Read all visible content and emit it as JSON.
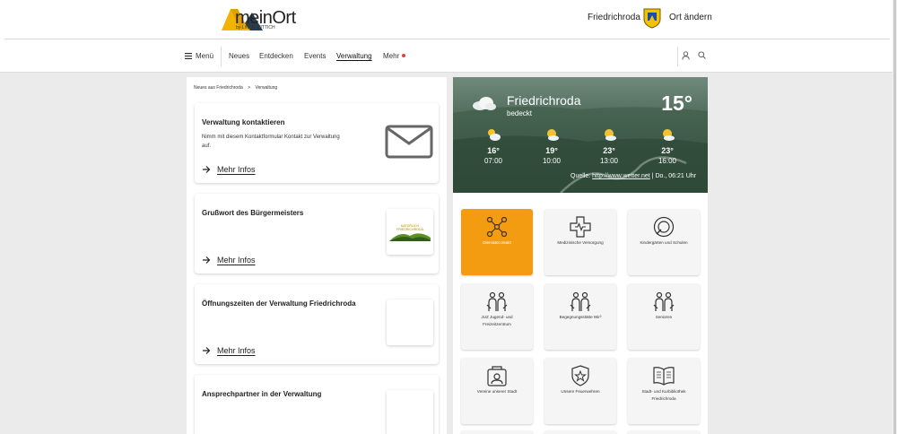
{
  "header": {
    "logo_text": "meinOrt",
    "logo_sub": "by LINUS WITTICH",
    "town": "Friedrichroda",
    "change_location": "Ort ändern"
  },
  "nav": {
    "menu": "Menü",
    "items": [
      "Neues",
      "Entdecken",
      "Events",
      "Verwaltung",
      "Mehr"
    ],
    "active": "Verwaltung"
  },
  "breadcrumb": [
    "Neues aus Friedrichroda",
    ">",
    "Verwaltung"
  ],
  "cards": [
    {
      "title": "Verwaltung kontaktieren",
      "text": "Nimm mit diesem Kontaktformular Kontakt zur Verwaltung auf.",
      "link": "Mehr Infos"
    },
    {
      "title": "Grußwort des Bürgermeisters",
      "text": "",
      "link": "Mehr Infos",
      "thumb_text": "NATÜRLICH FRIEDRICHRODA"
    },
    {
      "title": "Öffnungszeiten der Verwaltung Friedrichroda",
      "text": "",
      "link": "Mehr Infos"
    },
    {
      "title": "Ansprechpartner in der Verwaltung",
      "text": "",
      "link": ""
    }
  ],
  "weather": {
    "town": "Friedrichroda",
    "condition": "bedeckt",
    "current_temp": "15°",
    "hours": [
      {
        "temp": "16°",
        "time": "07:00"
      },
      {
        "temp": "19°",
        "time": "10:00"
      },
      {
        "temp": "23°",
        "time": "13:00"
      },
      {
        "temp": "23°",
        "time": "16:00"
      }
    ],
    "source_label": "Quelle:",
    "source_link": "http://www.wetter.net",
    "updated": "Do., 06:21 Uhr"
  },
  "tiles": [
    {
      "label": "Dienst&Kontakt",
      "icon": "network-icon",
      "active": true
    },
    {
      "label": "Medizinische Versorgung",
      "icon": "medical-cross-icon",
      "active": false
    },
    {
      "label": "Kindergärten und Schulen",
      "icon": "pacifier-icon",
      "active": false
    },
    {
      "label": "JUZ Jugend- und Freizeitzentrum",
      "icon": "people-hands-icon",
      "active": false
    },
    {
      "label": "Begegnungsstätte Wir²",
      "icon": "people-hands-icon",
      "active": false
    },
    {
      "label": "Senioren",
      "icon": "people-hands-icon",
      "active": false
    },
    {
      "label": "Vereine unserer Stadt",
      "icon": "clubs-icon",
      "active": false
    },
    {
      "label": "Unsere Feuerwehren",
      "icon": "fire-badge-icon",
      "active": false
    },
    {
      "label": "Stadt- und Kurbibliothek Friedrichroda",
      "icon": "book-icon",
      "active": false
    }
  ],
  "colors": {
    "accent": "#f39c12",
    "nav_dot": "#e04040",
    "logo_yellow": "#f2b400",
    "logo_dark": "#2a3d4f"
  }
}
